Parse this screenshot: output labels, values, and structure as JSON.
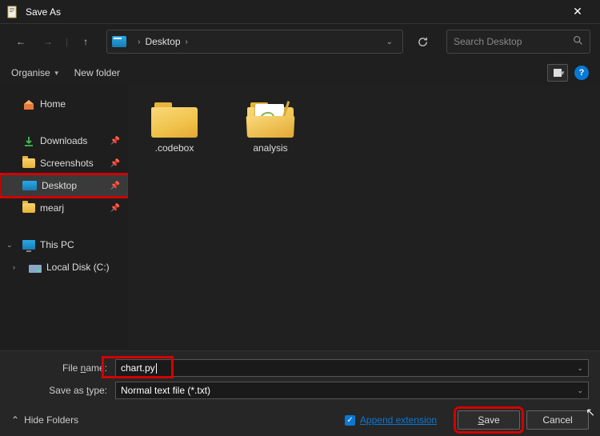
{
  "titlebar": {
    "title": "Save As"
  },
  "nav": {
    "breadcrumb": {
      "location": "Desktop"
    },
    "search_placeholder": "Search Desktop"
  },
  "toolbar": {
    "organise": "Organise",
    "new_folder": "New folder"
  },
  "sidebar": {
    "home": "Home",
    "pinned": [
      {
        "label": "Downloads"
      },
      {
        "label": "Screenshots"
      },
      {
        "label": "Desktop"
      },
      {
        "label": "mearj"
      }
    ],
    "this_pc": "This PC",
    "local_disk": "Local Disk (C:)"
  },
  "content": {
    "folders": [
      {
        "name": ".codebox",
        "filled": false
      },
      {
        "name": "analysis",
        "filled": true
      }
    ]
  },
  "footer": {
    "filename_label": "File name:",
    "filename_value": "chart.py",
    "savetype_label": "Save as type:",
    "savetype_value": "Normal text file (*.txt)",
    "hide_folders": "Hide Folders",
    "append_ext": "Append extension",
    "save": "Save",
    "cancel": "Cancel"
  }
}
